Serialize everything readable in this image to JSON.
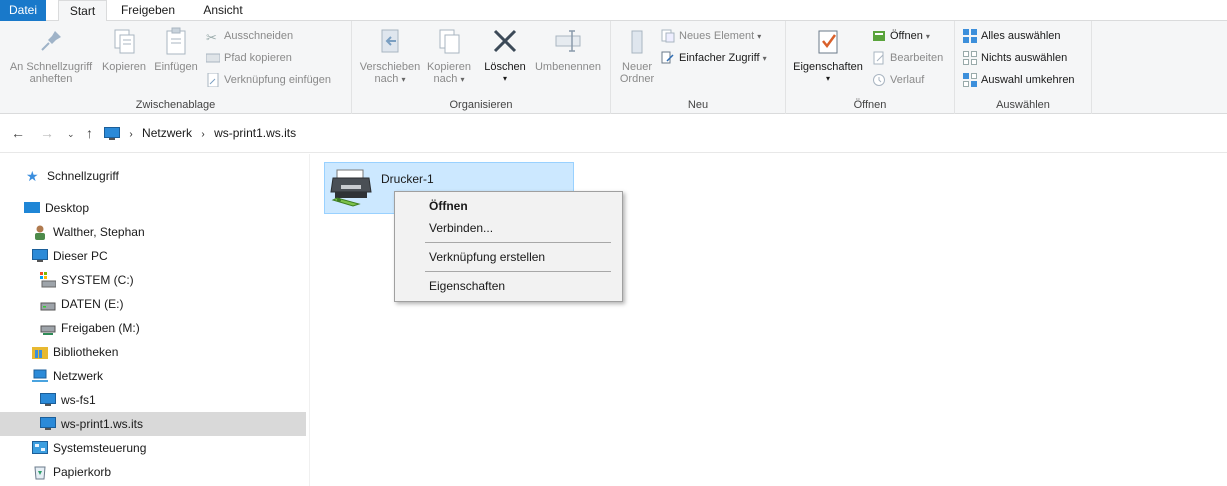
{
  "tabs": {
    "file": "Datei",
    "start": "Start",
    "share": "Freigeben",
    "view": "Ansicht"
  },
  "ribbon": {
    "clipboard": {
      "label": "Zwischenablage",
      "pin_line1": "An Schnellzugriff",
      "pin_line2": "anheften",
      "copy": "Kopieren",
      "paste": "Einfügen",
      "cut": "Ausschneiden",
      "copy_path": "Pfad kopieren",
      "paste_shortcut": "Verknüpfung einfügen"
    },
    "organize": {
      "label": "Organisieren",
      "move_line1": "Verschieben",
      "move_line2": "nach",
      "copyto_line1": "Kopieren",
      "copyto_line2": "nach",
      "delete": "Löschen",
      "rename": "Umbenennen"
    },
    "new": {
      "label": "Neu",
      "folder_line1": "Neuer",
      "folder_line2": "Ordner",
      "new_item": "Neues Element",
      "easy_access": "Einfacher Zugriff"
    },
    "open": {
      "label": "Öffnen",
      "properties": "Eigenschaften",
      "open": "Öffnen",
      "edit": "Bearbeiten",
      "history": "Verlauf"
    },
    "select": {
      "label": "Auswählen",
      "select_all": "Alles auswählen",
      "select_none": "Nichts auswählen",
      "invert": "Auswahl umkehren"
    }
  },
  "address": {
    "crumbs": [
      "Netzwerk",
      "ws-print1.ws.its"
    ]
  },
  "nav": {
    "items": [
      "Schnellzugriff",
      "Desktop",
      "Walther, Stephan",
      "Dieser PC",
      "SYSTEM (C:)",
      "DATEN (E:)",
      "Freigaben (M:)",
      "Bibliotheken",
      "Netzwerk",
      "ws-fs1",
      "ws-print1.ws.its",
      "Systemsteuerung",
      "Papierkorb"
    ]
  },
  "content": {
    "item_name": "Drucker-1"
  },
  "context_menu": {
    "open": "Öffnen",
    "connect": "Verbinden...",
    "create_shortcut": "Verknüpfung erstellen",
    "properties": "Eigenschaften"
  },
  "colors": {
    "accent": "#1979ca",
    "selection": "#cce8ff",
    "selection_border": "#99d1ff"
  }
}
